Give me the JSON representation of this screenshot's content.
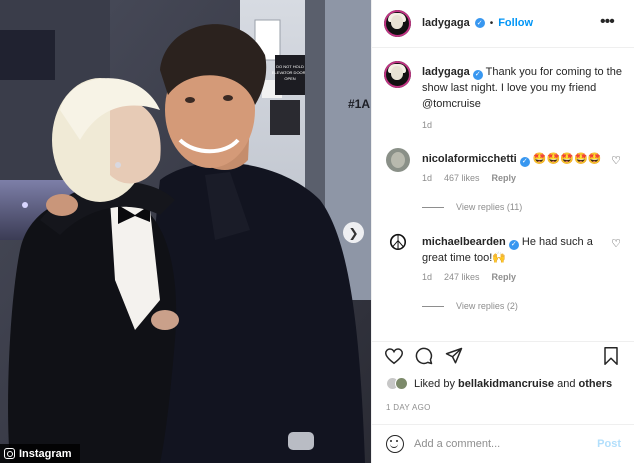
{
  "post": {
    "author": "ladygaga",
    "follow_label": "Follow",
    "more_icon": "more-horizontal-icon",
    "separator": "•"
  },
  "caption": {
    "username": "ladygaga",
    "text": "Thank you for coming to the show last night. I love you my friend @tomcruise",
    "age": "1d"
  },
  "media": {
    "door_sign_lines": [
      "DO NOT HOLD",
      "ELEVATOR DOORS",
      "OPEN"
    ],
    "elevator_number": "#1A",
    "next_icon": "chevron-right-icon"
  },
  "comments": [
    {
      "username": "nicolaformicchetti",
      "text": "🤩🤩🤩🤩🤩",
      "age": "1d",
      "likes": "467 likes",
      "reply_label": "Reply",
      "view_replies": "View replies (11)"
    },
    {
      "username": "michaelbearden",
      "text": "He had such a great time too!🙌",
      "age": "1d",
      "likes": "247 likes",
      "reply_label": "Reply",
      "view_replies": "View replies (2)"
    }
  ],
  "actions": {
    "like_icon": "heart-icon",
    "comment_icon": "comment-icon",
    "share_icon": "send-icon",
    "save_icon": "bookmark-icon"
  },
  "likes": {
    "prefix": "Liked by",
    "user": "bellakidmancruise",
    "conjunction": "and",
    "others": "others"
  },
  "timestamp": "1 DAY AGO",
  "add_comment": {
    "placeholder": "Add a comment...",
    "post_label": "Post",
    "emoji_icon": "smiley-icon"
  },
  "watermark": "Instagram",
  "colors": {
    "link": "#0095f6",
    "verified": "#3897f0",
    "muted": "#8e8e8e",
    "post_disabled": "#b2dffc"
  }
}
